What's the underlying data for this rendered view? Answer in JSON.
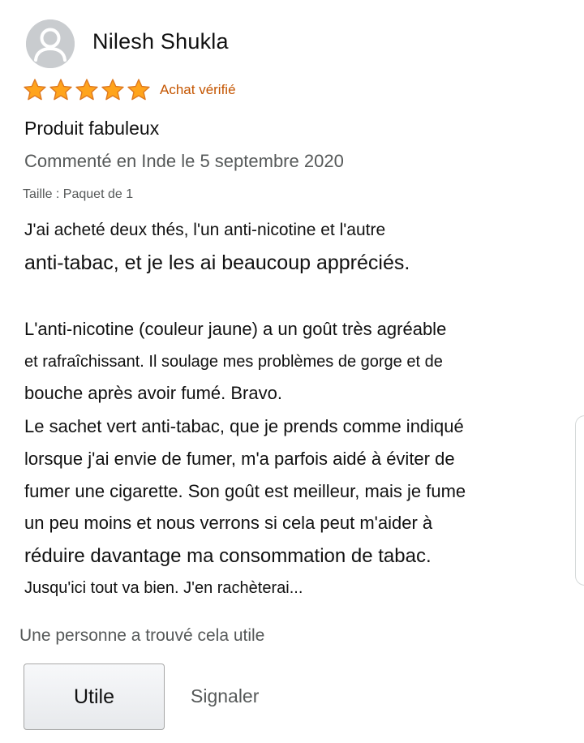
{
  "review": {
    "reviewer_name": "Nilesh Shukla",
    "rating": 5,
    "rating_max": 5,
    "verified_label": "Achat vérifié",
    "title": "Produit fabuleux",
    "date_line": "Commenté en Inde le 5 septembre 2020",
    "variant": "Taille : Paquet de 1",
    "body_lines": [
      "J'ai acheté deux thés, l'un anti-nicotine et l'autre",
      "anti-tabac, et je les ai beaucoup appréciés.",
      "L'anti-nicotine (couleur jaune) a un goût très agréable",
      "et rafraîchissant. Il soulage mes problèmes de gorge et de",
      "bouche après avoir fumé. Bravo.",
      "Le sachet vert anti-tabac, que je prends comme indiqué",
      "lorsque j'ai envie de fumer, m'a parfois aidé à éviter de",
      "fumer une cigarette. Son goût est meilleur, mais je fume",
      "un peu moins et nous verrons si cela peut m'aider à",
      "réduire davantage ma consommation de tabac.",
      "Jusqu'ici tout va bien. J'en rachèterai..."
    ],
    "helpful_count": "Une personne a trouvé cela utile",
    "helpful_button": "Utile",
    "report_link": "Signaler"
  },
  "colors": {
    "star": "#ffa41c",
    "star_outline": "#de7921",
    "verified": "#c45500",
    "secondary_text": "#565959",
    "avatar_bg": "#c9cccf"
  },
  "icons": {
    "avatar": "user-silhouette-icon",
    "star": "star-filled-icon"
  }
}
